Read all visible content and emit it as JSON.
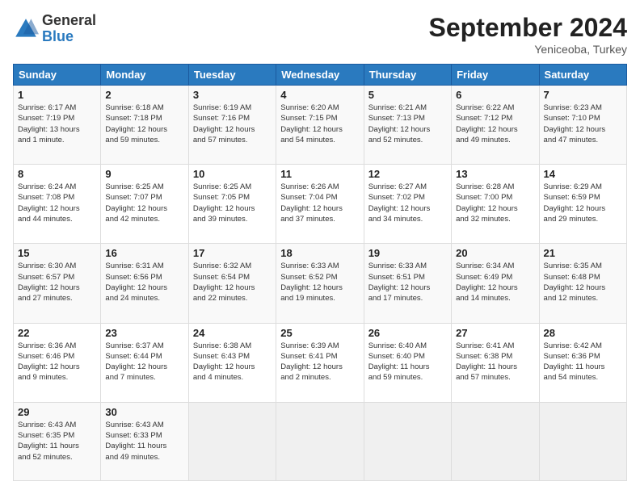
{
  "header": {
    "logo_general": "General",
    "logo_blue": "Blue",
    "month_title": "September 2024",
    "subtitle": "Yeniceoba, Turkey"
  },
  "days_of_week": [
    "Sunday",
    "Monday",
    "Tuesday",
    "Wednesday",
    "Thursday",
    "Friday",
    "Saturday"
  ],
  "weeks": [
    [
      {
        "day": "1",
        "info": "Sunrise: 6:17 AM\nSunset: 7:19 PM\nDaylight: 13 hours\nand 1 minute."
      },
      {
        "day": "2",
        "info": "Sunrise: 6:18 AM\nSunset: 7:18 PM\nDaylight: 12 hours\nand 59 minutes."
      },
      {
        "day": "3",
        "info": "Sunrise: 6:19 AM\nSunset: 7:16 PM\nDaylight: 12 hours\nand 57 minutes."
      },
      {
        "day": "4",
        "info": "Sunrise: 6:20 AM\nSunset: 7:15 PM\nDaylight: 12 hours\nand 54 minutes."
      },
      {
        "day": "5",
        "info": "Sunrise: 6:21 AM\nSunset: 7:13 PM\nDaylight: 12 hours\nand 52 minutes."
      },
      {
        "day": "6",
        "info": "Sunrise: 6:22 AM\nSunset: 7:12 PM\nDaylight: 12 hours\nand 49 minutes."
      },
      {
        "day": "7",
        "info": "Sunrise: 6:23 AM\nSunset: 7:10 PM\nDaylight: 12 hours\nand 47 minutes."
      }
    ],
    [
      {
        "day": "8",
        "info": "Sunrise: 6:24 AM\nSunset: 7:08 PM\nDaylight: 12 hours\nand 44 minutes."
      },
      {
        "day": "9",
        "info": "Sunrise: 6:25 AM\nSunset: 7:07 PM\nDaylight: 12 hours\nand 42 minutes."
      },
      {
        "day": "10",
        "info": "Sunrise: 6:25 AM\nSunset: 7:05 PM\nDaylight: 12 hours\nand 39 minutes."
      },
      {
        "day": "11",
        "info": "Sunrise: 6:26 AM\nSunset: 7:04 PM\nDaylight: 12 hours\nand 37 minutes."
      },
      {
        "day": "12",
        "info": "Sunrise: 6:27 AM\nSunset: 7:02 PM\nDaylight: 12 hours\nand 34 minutes."
      },
      {
        "day": "13",
        "info": "Sunrise: 6:28 AM\nSunset: 7:00 PM\nDaylight: 12 hours\nand 32 minutes."
      },
      {
        "day": "14",
        "info": "Sunrise: 6:29 AM\nSunset: 6:59 PM\nDaylight: 12 hours\nand 29 minutes."
      }
    ],
    [
      {
        "day": "15",
        "info": "Sunrise: 6:30 AM\nSunset: 6:57 PM\nDaylight: 12 hours\nand 27 minutes."
      },
      {
        "day": "16",
        "info": "Sunrise: 6:31 AM\nSunset: 6:56 PM\nDaylight: 12 hours\nand 24 minutes."
      },
      {
        "day": "17",
        "info": "Sunrise: 6:32 AM\nSunset: 6:54 PM\nDaylight: 12 hours\nand 22 minutes."
      },
      {
        "day": "18",
        "info": "Sunrise: 6:33 AM\nSunset: 6:52 PM\nDaylight: 12 hours\nand 19 minutes."
      },
      {
        "day": "19",
        "info": "Sunrise: 6:33 AM\nSunset: 6:51 PM\nDaylight: 12 hours\nand 17 minutes."
      },
      {
        "day": "20",
        "info": "Sunrise: 6:34 AM\nSunset: 6:49 PM\nDaylight: 12 hours\nand 14 minutes."
      },
      {
        "day": "21",
        "info": "Sunrise: 6:35 AM\nSunset: 6:48 PM\nDaylight: 12 hours\nand 12 minutes."
      }
    ],
    [
      {
        "day": "22",
        "info": "Sunrise: 6:36 AM\nSunset: 6:46 PM\nDaylight: 12 hours\nand 9 minutes."
      },
      {
        "day": "23",
        "info": "Sunrise: 6:37 AM\nSunset: 6:44 PM\nDaylight: 12 hours\nand 7 minutes."
      },
      {
        "day": "24",
        "info": "Sunrise: 6:38 AM\nSunset: 6:43 PM\nDaylight: 12 hours\nand 4 minutes."
      },
      {
        "day": "25",
        "info": "Sunrise: 6:39 AM\nSunset: 6:41 PM\nDaylight: 12 hours\nand 2 minutes."
      },
      {
        "day": "26",
        "info": "Sunrise: 6:40 AM\nSunset: 6:40 PM\nDaylight: 11 hours\nand 59 minutes."
      },
      {
        "day": "27",
        "info": "Sunrise: 6:41 AM\nSunset: 6:38 PM\nDaylight: 11 hours\nand 57 minutes."
      },
      {
        "day": "28",
        "info": "Sunrise: 6:42 AM\nSunset: 6:36 PM\nDaylight: 11 hours\nand 54 minutes."
      }
    ],
    [
      {
        "day": "29",
        "info": "Sunrise: 6:43 AM\nSunset: 6:35 PM\nDaylight: 11 hours\nand 52 minutes."
      },
      {
        "day": "30",
        "info": "Sunrise: 6:43 AM\nSunset: 6:33 PM\nDaylight: 11 hours\nand 49 minutes."
      },
      {
        "day": "",
        "info": ""
      },
      {
        "day": "",
        "info": ""
      },
      {
        "day": "",
        "info": ""
      },
      {
        "day": "",
        "info": ""
      },
      {
        "day": "",
        "info": ""
      }
    ]
  ]
}
